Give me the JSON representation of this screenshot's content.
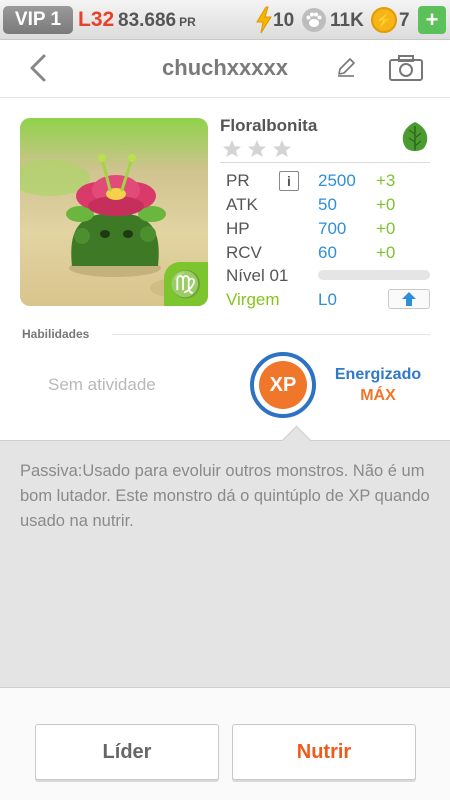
{
  "topbar": {
    "vip": "VIP 1",
    "level": "L32",
    "pr_total": "83.686",
    "pr_unit": "PR",
    "energy": "10",
    "paws": "11K",
    "coins": "7",
    "icons": [
      "bolt-icon",
      "paw-icon",
      "coin-icon",
      "plus-icon"
    ]
  },
  "header": {
    "title": "chuchxxxxx",
    "icons": [
      "back-icon",
      "edit-icon",
      "camera-icon"
    ]
  },
  "monster": {
    "name": "Floralbonita",
    "stars_total": 3,
    "element": "leaf",
    "zodiac_symbol": "♍",
    "stats": [
      {
        "label": "PR",
        "value": "2500",
        "bonus": "+3"
      },
      {
        "label": "ATK",
        "value": "50",
        "bonus": "+0"
      },
      {
        "label": "HP",
        "value": "700",
        "bonus": "+0"
      },
      {
        "label": "RCV",
        "value": "60",
        "bonus": "+0"
      }
    ],
    "level_label": "Nível 01",
    "level_progress": 0,
    "zodiac_name": "Virgem",
    "limit": "L0",
    "info_symbol": "i"
  },
  "abilities": {
    "label": "Habilidades",
    "no_activity": "Sem atividade",
    "xp_badge": "XP",
    "energized": "Energizado",
    "max": "MÁX"
  },
  "description": {
    "text": "Passiva:Usado para evoluir outros monstros. Não é um bom lutador. Este monstro dá o quintúplo de XP quando usado na nutrir."
  },
  "buttons": {
    "leader": "Líder",
    "feed": "Nutrir"
  },
  "colors": {
    "accent_blue": "#2f8fd8",
    "bonus_green": "#7cc52f",
    "feed_orange": "#f05a1a",
    "level_red": "#e8412a"
  }
}
